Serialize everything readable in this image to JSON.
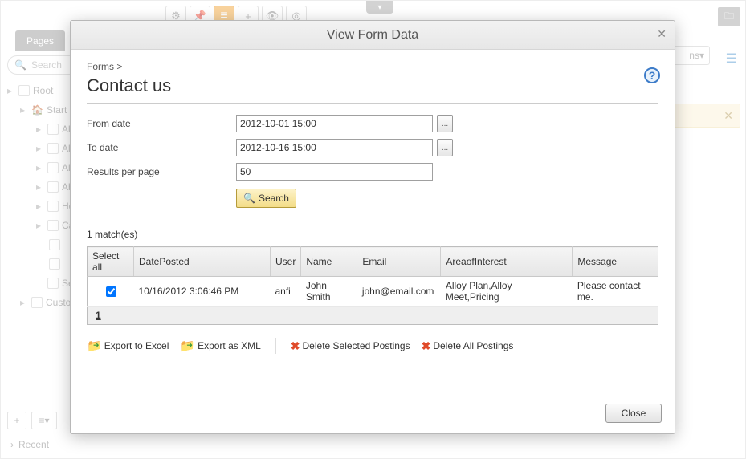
{
  "bg": {
    "tab_pages": "Pages",
    "search_placeholder": "Search",
    "tree": {
      "root": "Root",
      "start": "Start",
      "alloy1": "All",
      "alloy2": "All",
      "alloy3": "All",
      "about": "Ab",
      "how": "Ho",
      "camp": "Ca",
      "search": "Se",
      "cust": "Custo"
    },
    "recent": "Recent",
    "options": "ns"
  },
  "modal": {
    "title": "View Form Data",
    "breadcrumb": "Forms >",
    "heading": "Contact us",
    "form": {
      "from_label": "From date",
      "from_value": "2012-10-01 15:00",
      "to_label": "To date",
      "to_value": "2012-10-16 15:00",
      "rpp_label": "Results per page",
      "rpp_value": "50",
      "search_label": "Search"
    },
    "matches": "1 match(es)",
    "table": {
      "headers": {
        "select": "Select all",
        "date": "DatePosted",
        "user": "User",
        "name": "Name",
        "email": "Email",
        "area": "AreaofInterest",
        "message": "Message"
      },
      "row": {
        "date": "10/16/2012 3:06:46 PM",
        "user": "anfi",
        "name": "John Smith",
        "email": "john@email.com",
        "area": "Alloy Plan,Alloy Meet,Pricing",
        "message": "Please contact me."
      },
      "page": "1"
    },
    "actions": {
      "export_excel": "Export to Excel",
      "export_xml": "Export as XML",
      "delete_selected": "Delete Selected Postings",
      "delete_all": "Delete All Postings"
    },
    "close": "Close"
  }
}
